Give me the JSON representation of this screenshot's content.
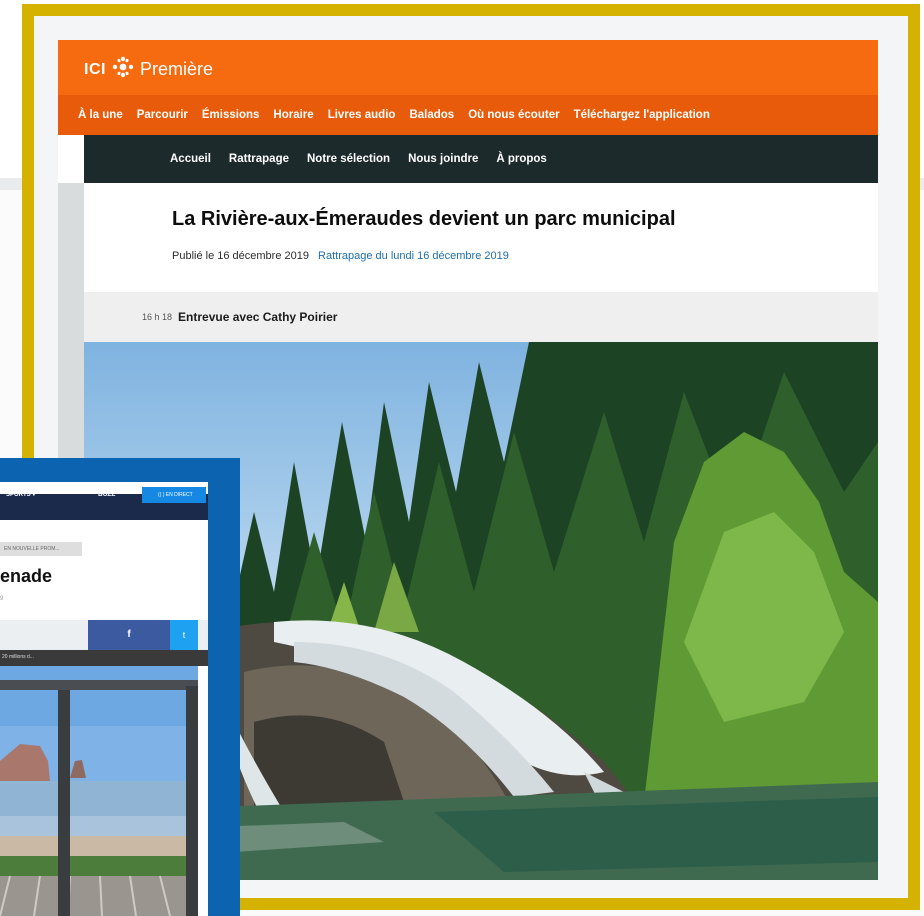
{
  "main": {
    "logo": {
      "ici": "ICI",
      "name": "Première",
      "gem_icon": "radio-canada-gem-icon"
    },
    "nav": [
      "À la une",
      "Parcourir",
      "Émissions",
      "Horaire",
      "Livres audio",
      "Balados",
      "Où nous écouter",
      "Téléchargez l'application"
    ],
    "subnav": [
      "Accueil",
      "Rattrapage",
      "Notre sélection",
      "Nous joindre",
      "À propos"
    ],
    "article": {
      "title": "La Rivière-aux-Émeraudes devient un parc municipal",
      "published": "Publié le 16 décembre 2019",
      "rattrapage": "Rattrapage du lundi 16 décembre 2019"
    },
    "segment": {
      "time": "16 h 18",
      "title": "Entrevue avec Cathy Poirier"
    }
  },
  "secondary": {
    "nav": {
      "sports": "SPORTS ▾",
      "buzz": "BUZZ",
      "badge": "(( ) EN DIRECT"
    },
    "breadcrumb": "EN NOUVELLE PROM...",
    "headline_fragment": "enade",
    "meta_fragment": "9",
    "share": {
      "facebook": "f",
      "twitter": "t"
    },
    "caption_fragment": "20 millions d..."
  },
  "colors": {
    "gold_frame": "#d5b100",
    "orange_top": "#f66a10",
    "orange_nav": "#e85b0a",
    "dark_subnav": "#1d2a2c",
    "link_blue": "#1f6fae",
    "blue_frame": "#0c64b1",
    "facebook": "#3b5aa0",
    "twitter": "#1ea1f1"
  }
}
